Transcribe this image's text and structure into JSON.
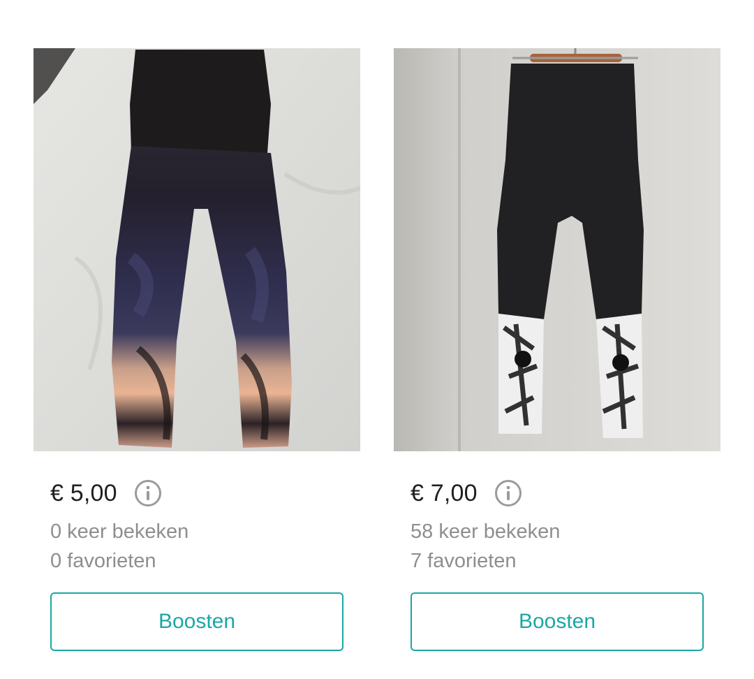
{
  "items": [
    {
      "price": "€ 5,00",
      "views": "0 keer bekeken",
      "favorites": "0 favorieten",
      "boost_label": "Boosten",
      "info_icon": "info-icon"
    },
    {
      "price": "€ 7,00",
      "views": "58 keer bekeken",
      "favorites": "7 favorieten",
      "boost_label": "Boosten",
      "info_icon": "info-icon"
    }
  ],
  "colors": {
    "accent": "#1aa7a5",
    "price_text": "#1f1f1f",
    "muted_text": "#8e8e8e",
    "icon_gray": "#9a9a9a"
  }
}
